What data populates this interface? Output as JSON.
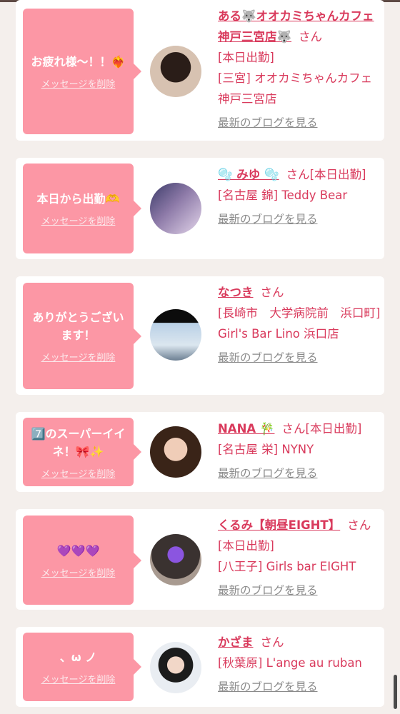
{
  "cards": [
    {
      "message": "お疲れ様〜！！❤️‍🔥",
      "delete_label": "メッセージを削除",
      "name": "ある🐺オオカミちゃんカフェ神戸三宮店🐺",
      "suffix": "さん",
      "line1": "[本日出勤]",
      "line2": "[三宮] オオカミちゃんカフェ神戸三宮店",
      "blog_label": "最新のブログを見る"
    },
    {
      "message": "本日から出勤🫶",
      "delete_label": "メッセージを削除",
      "name": "🫧 みゆ 🫧",
      "suffix": "さん[本日出勤]",
      "line1": "",
      "line2": "[名古屋 錦] Teddy Bear",
      "blog_label": "最新のブログを見る"
    },
    {
      "message": "ありがとうございます！",
      "delete_label": "メッセージを削除",
      "name": "なつき",
      "suffix": "さん",
      "line1": "",
      "line2": "[長崎市　大学病院前　浜口町] Girl's Bar Lino 浜口店",
      "blog_label": "最新のブログを見る"
    },
    {
      "message": "7️⃣のスーパーイイネ！🎀✨",
      "delete_label": "メッセージを削除",
      "name": "NANA 🎋",
      "suffix": "さん[本日出勤]",
      "line1": "",
      "line2": "[名古屋 栄] NYNY",
      "blog_label": "最新のブログを見る"
    },
    {
      "message": "💜💜💜",
      "delete_label": "メッセージを削除",
      "name": "くるみ【朝昼EIGHT】",
      "suffix": "さん[本日出勤]",
      "line1": "",
      "line2": "[八王子] Girls bar EIGHT",
      "blog_label": "最新のブログを見る"
    },
    {
      "message": "、ω ノ",
      "delete_label": "メッセージを削除",
      "name": "かざま",
      "suffix": "さん",
      "line1": "",
      "line2": "[秋葉原] L'ange au ruban",
      "blog_label": "最新のブログを見る"
    }
  ]
}
